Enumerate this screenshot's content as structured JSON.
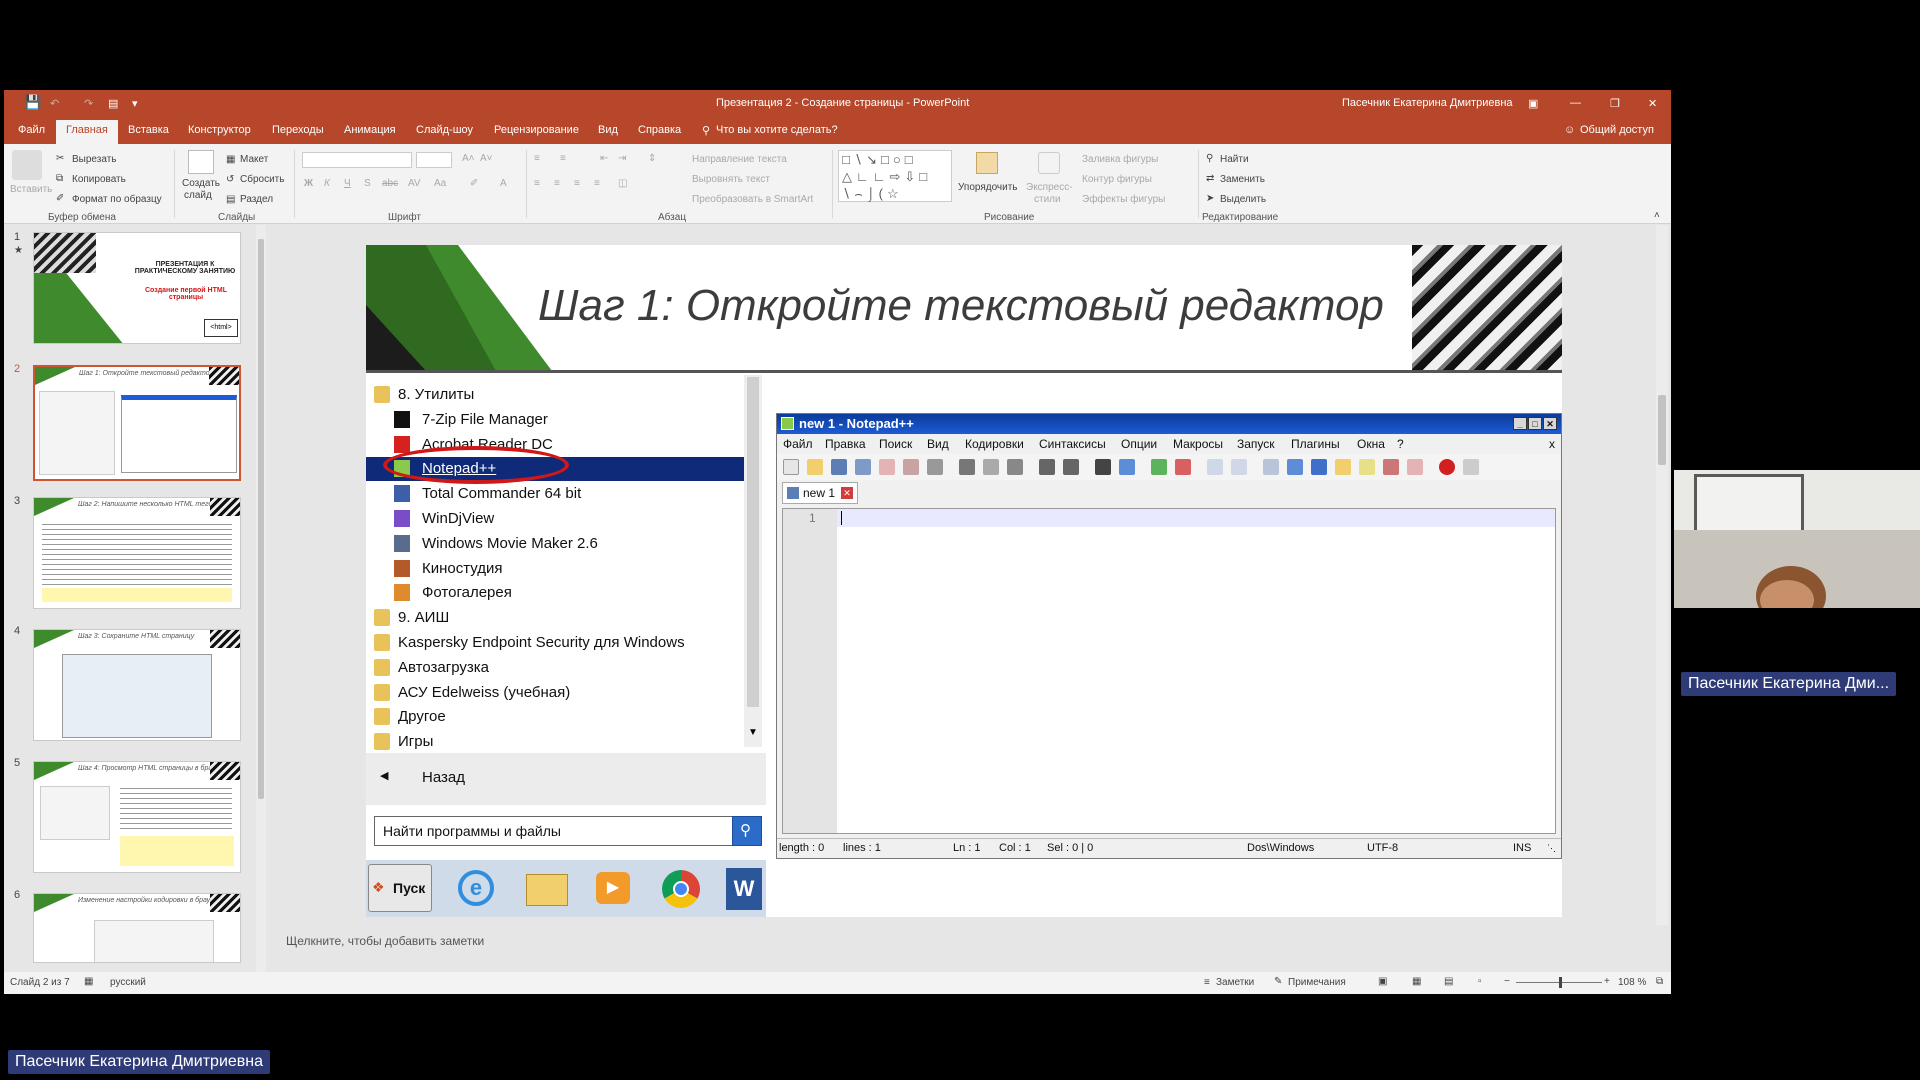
{
  "window": {
    "title": "Презентация 2 - Создание страницы - PowerPoint",
    "user": "Пасечник Екатерина Дмитриевна",
    "share": "Общий доступ"
  },
  "ribbon_tabs": [
    "Файл",
    "Главная",
    "Вставка",
    "Конструктор",
    "Переходы",
    "Анимация",
    "Слайд-шоу",
    "Рецензирование",
    "Вид",
    "Справка"
  ],
  "tell_me": "Что вы хотите сделать?",
  "clipboard": {
    "paste": "Вставить",
    "cut": "Вырезать",
    "copy": "Копировать",
    "format": "Формат по образцу",
    "group": "Буфер обмена"
  },
  "slides_group": {
    "new_slide_1": "Создать",
    "new_slide_2": "слайд",
    "layout": "Макет",
    "reset": "Сбросить",
    "section": "Раздел",
    "group": "Слайды"
  },
  "font_group": {
    "group": "Шрифт"
  },
  "paragraph_group": {
    "text_direction": "Направление текста",
    "align_text": "Выровнять текст",
    "smartart": "Преобразовать в SmartArt",
    "group": "Абзац"
  },
  "drawing_group": {
    "arrange": "Упорядочить",
    "quick_styles_1": "Экспресс-",
    "quick_styles_2": "стили",
    "shape_fill": "Заливка фигуры",
    "shape_outline": "Контур фигуры",
    "shape_effects": "Эффекты фигуры",
    "group": "Рисование"
  },
  "editing_group": {
    "find": "Найти",
    "replace": "Заменить",
    "select": "Выделить",
    "group": "Редактирование"
  },
  "thumbnails": [
    {
      "num": "1",
      "title": "ПРЕЗЕНТАЦИЯ К ПРАКТИЧЕСКОМУ ЗАНЯТИЮ",
      "subtitle": "Создание первой HTML страницы",
      "tag": "<html>"
    },
    {
      "num": "2",
      "title": "Шаг 1: Откройте текстовый редактор"
    },
    {
      "num": "3",
      "title": "Шаг 2: Напишите несколько HTML тегов"
    },
    {
      "num": "4",
      "title": "Шаг 3: Сохраните HTML страницу"
    },
    {
      "num": "5",
      "title": "Шаг 4: Просмотр HTML страницы в браузере"
    },
    {
      "num": "6",
      "title": "Изменение настройки кодировки в браузере"
    }
  ],
  "slide": {
    "title": "Шаг 1: Откройте текстовый редактор"
  },
  "start_menu": {
    "items": [
      {
        "label": "8. Утилиты",
        "icon": "folder-icon",
        "indent": false
      },
      {
        "label": "7-Zip File Manager",
        "icon": "7zip-icon",
        "indent": true
      },
      {
        "label": "Acrobat Reader DC",
        "icon": "acrobat-icon",
        "indent": true
      },
      {
        "label": "Notepad++",
        "icon": "notepadpp-icon",
        "indent": true,
        "highlighted": true
      },
      {
        "label": "Total Commander 64 bit",
        "icon": "total-commander-icon",
        "indent": true
      },
      {
        "label": "WinDjView",
        "icon": "windjview-icon",
        "indent": true
      },
      {
        "label": "Windows Movie Maker 2.6",
        "icon": "movie-maker-icon",
        "indent": true
      },
      {
        "label": "Киностудия",
        "icon": "kinostudio-icon",
        "indent": true
      },
      {
        "label": "Фотогалерея",
        "icon": "photo-gallery-icon",
        "indent": true
      },
      {
        "label": "9. АИШ",
        "icon": "folder-icon",
        "indent": false
      },
      {
        "label": "Kaspersky Endpoint Security для Windows",
        "icon": "folder-icon",
        "indent": false
      },
      {
        "label": "Автозагрузка",
        "icon": "folder-icon",
        "indent": false
      },
      {
        "label": "АСУ Edelweiss (учебная)",
        "icon": "folder-icon",
        "indent": false
      },
      {
        "label": "Другое",
        "icon": "folder-icon",
        "indent": false
      },
      {
        "label": "Игры",
        "icon": "folder-icon",
        "indent": false
      }
    ],
    "back": "Назад",
    "search_placeholder": "Найти программы и файлы",
    "start_button": "Пуск"
  },
  "notepad": {
    "title": "new 1 - Notepad++",
    "menu": [
      "Файл",
      "Правка",
      "Поиск",
      "Вид",
      "Кодировки",
      "Синтаксисы",
      "Опции",
      "Макросы",
      "Запуск",
      "Плагины",
      "Окна",
      "?"
    ],
    "tab": "new 1",
    "line_number": "1",
    "status": {
      "length": "length : 0",
      "lines": "lines : 1",
      "ln": "Ln : 1",
      "col": "Col : 1",
      "sel": "Sel : 0 | 0",
      "eol": "Dos\\Windows",
      "encoding": "UTF-8",
      "mode": "INS"
    }
  },
  "notes_placeholder": "Щелкните, чтобы добавить заметки",
  "statusbar": {
    "slide": "Слайд 2 из 7",
    "language": "русский",
    "notes": "Заметки",
    "comments": "Примечания",
    "zoom": "108 %"
  },
  "zoom_percent": 108,
  "webcam": {
    "name": "Пасечник Екатерина Дми..."
  },
  "bottom_name": "Пасечник Екатерина Дмитриевна",
  "colors": {
    "accent": "#b7472a",
    "highlight": "#0f2a78",
    "nameplate": "#2e3b77",
    "annotation": "#d01818"
  }
}
